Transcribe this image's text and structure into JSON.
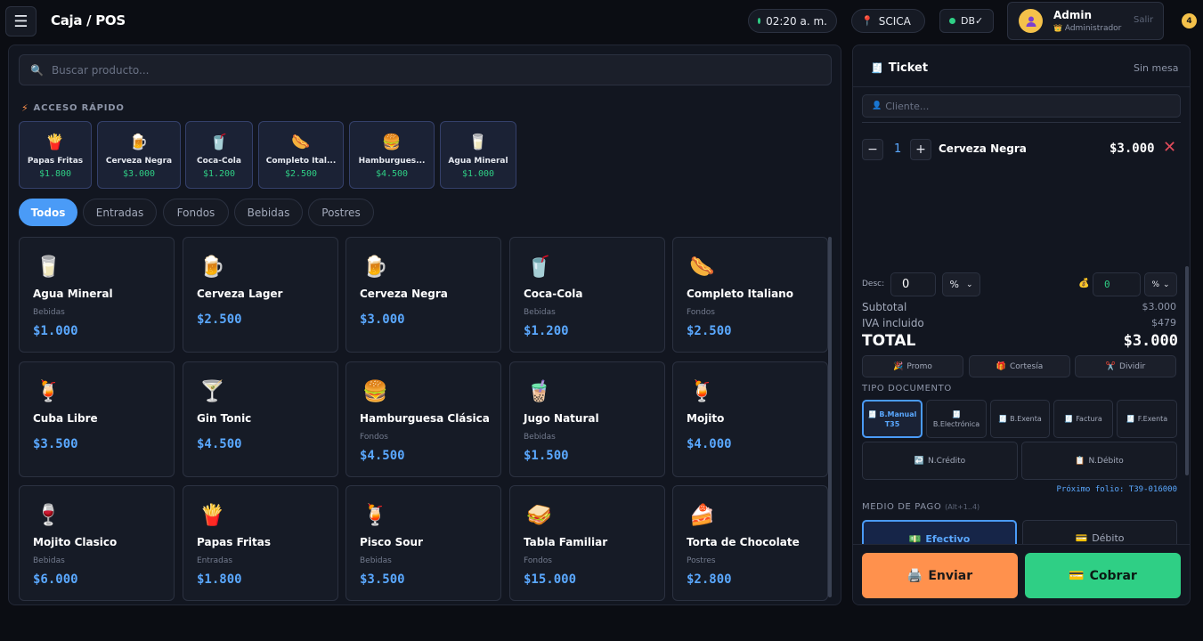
{
  "header": {
    "menu_icon": "☰",
    "title": "Caja / POS",
    "time": "02:20 a. m.",
    "location": "SCICA",
    "db": "DB✓",
    "user_name": "Admin",
    "user_role": "Administrador",
    "logout": "Salir",
    "notifications": "4"
  },
  "catalog": {
    "search_placeholder": "Buscar producto...",
    "quick_label": "ACCESO RÁPIDO",
    "quick_items": [
      {
        "icon": "🍟",
        "name": "Papas Fritas",
        "price": "$1.800"
      },
      {
        "icon": "🍺",
        "name": "Cerveza Negra",
        "price": "$3.000"
      },
      {
        "icon": "🥤",
        "name": "Coca-Cola",
        "price": "$1.200"
      },
      {
        "icon": "🌭",
        "name": "Completo Ital...",
        "price": "$2.500"
      },
      {
        "icon": "🍔",
        "name": "Hamburgues...",
        "price": "$4.500"
      },
      {
        "icon": "🥛",
        "name": "Agua Mineral",
        "price": "$1.000"
      }
    ],
    "tabs": [
      "Todos",
      "Entradas",
      "Fondos",
      "Bebidas",
      "Postres"
    ],
    "products": [
      {
        "icon": "🥛",
        "name": "Agua Mineral",
        "category": "Bebidas",
        "price": "$1.000"
      },
      {
        "icon": "🍺",
        "name": "Cerveza Lager",
        "category": "",
        "price": "$2.500"
      },
      {
        "icon": "🍺",
        "name": "Cerveza Negra",
        "category": "",
        "price": "$3.000"
      },
      {
        "icon": "🥤",
        "name": "Coca-Cola",
        "category": "Bebidas",
        "price": "$1.200"
      },
      {
        "icon": "🌭",
        "name": "Completo Italiano",
        "category": "Fondos",
        "price": "$2.500"
      },
      {
        "icon": "🍹",
        "name": "Cuba Libre",
        "category": "",
        "price": "$3.500"
      },
      {
        "icon": "🍸",
        "name": "Gin Tonic",
        "category": "",
        "price": "$4.500"
      },
      {
        "icon": "🍔",
        "name": "Hamburguesa Clásica",
        "category": "Fondos",
        "price": "$4.500"
      },
      {
        "icon": "🧋",
        "name": "Jugo Natural",
        "category": "Bebidas",
        "price": "$1.500"
      },
      {
        "icon": "🍹",
        "name": "Mojito",
        "category": "",
        "price": "$4.000"
      },
      {
        "icon": "🍷",
        "name": "Mojito Clasico",
        "category": "Bebidas",
        "price": "$6.000"
      },
      {
        "icon": "🍟",
        "name": "Papas Fritas",
        "category": "Entradas",
        "price": "$1.800"
      },
      {
        "icon": "🍹",
        "name": "Pisco Sour",
        "category": "Bebidas",
        "price": "$3.500"
      },
      {
        "icon": "🥪",
        "name": "Tabla Familiar",
        "category": "Fondos",
        "price": "$15.000"
      },
      {
        "icon": "🍰",
        "name": "Torta de Chocolate",
        "category": "Postres",
        "price": "$2.800"
      }
    ]
  },
  "ticket": {
    "icon": "🧾",
    "title": "Ticket",
    "table": "Sin mesa",
    "client_icon": "👤",
    "client_placeholder": "Cliente...",
    "line": {
      "minus": "−",
      "qty": "1",
      "plus": "+",
      "name": "Cerveza Negra",
      "price": "$3.000",
      "remove": "✕"
    },
    "discount_label": "Desc:",
    "discount_value": "0",
    "discount_type": "%",
    "tip_icon": "💰",
    "tip_value": "0",
    "tip_type": "%",
    "subtotal_label": "Subtotal",
    "subtotal_value": "$3.000",
    "iva_label": "IVA incluido",
    "iva_value": "$479",
    "total_label": "TOTAL",
    "total_value": "$3.000",
    "actions": [
      {
        "icon": "🎉",
        "label": "Promo"
      },
      {
        "icon": "🎁",
        "label": "Cortesía"
      },
      {
        "icon": "✂️",
        "label": "Dividir"
      }
    ],
    "doc_label": "TIPO DOCUMENTO",
    "doc_types": [
      {
        "icon": "🧾",
        "label": "B.Manual",
        "sub": "T35"
      },
      {
        "icon": "🧾",
        "label": "B.Electrónica",
        "sub": ""
      },
      {
        "icon": "🧾",
        "label": "B.Exenta",
        "sub": ""
      },
      {
        "icon": "🧾",
        "label": "Factura",
        "sub": ""
      },
      {
        "icon": "🧾",
        "label": "F.Exenta",
        "sub": ""
      }
    ],
    "doc_types2": [
      {
        "icon": "↩️",
        "label": "N.Crédito"
      },
      {
        "icon": "📋",
        "label": "N.Débito"
      }
    ],
    "folio": "Próximo folio: T39-016000",
    "payment_label": "MEDIO DE PAGO",
    "payment_hint": "(Alt+1..4)",
    "payments": [
      {
        "icon": "💵",
        "label": "Efectivo"
      },
      {
        "icon": "💳",
        "label": "Débito"
      }
    ],
    "send": {
      "icon": "🖨️",
      "label": "Enviar"
    },
    "charge": {
      "icon": "💳",
      "label": "Cobrar"
    }
  },
  "colors": {
    "accent": "#4a9bf7",
    "success": "#2fcf85",
    "warning": "#ff914d",
    "danger": "#e24b5b"
  }
}
